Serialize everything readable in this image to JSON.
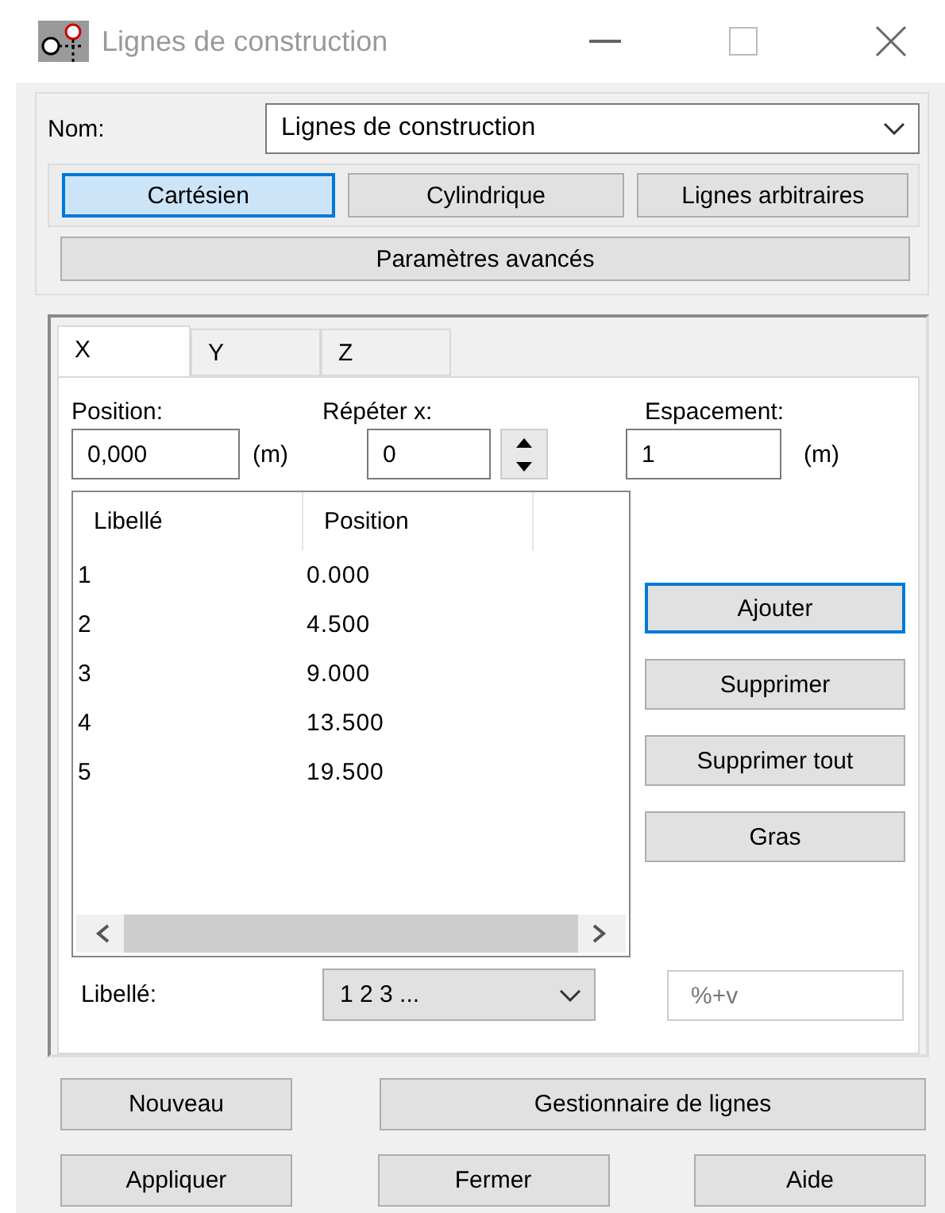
{
  "window": {
    "title": "Lignes de construction",
    "active": false
  },
  "name": {
    "label": "Nom:",
    "value": "Lignes de construction"
  },
  "modes": [
    {
      "label": "Cartésien",
      "selected": true
    },
    {
      "label": "Cylindrique",
      "selected": false
    },
    {
      "label": "Lignes arbitraires",
      "selected": false
    }
  ],
  "advanced_button": "Paramètres avancés",
  "tabs": [
    {
      "label": "X",
      "selected": true
    },
    {
      "label": "Y",
      "selected": false
    },
    {
      "label": "Z",
      "selected": false
    }
  ],
  "position": {
    "label": "Position:",
    "value": "0,000",
    "unit": "(m)"
  },
  "repeat": {
    "label": "Répéter x:",
    "value": "0"
  },
  "spacing": {
    "label": "Espacement:",
    "value": "1",
    "unit": "(m)"
  },
  "table": {
    "columns": [
      "Libellé",
      "Position"
    ],
    "rows": [
      [
        "1",
        "0.000"
      ],
      [
        "2",
        "4.500"
      ],
      [
        "3",
        "9.000"
      ],
      [
        "4",
        "13.500"
      ],
      [
        "5",
        "19.500"
      ]
    ]
  },
  "side_buttons": [
    {
      "label": "Ajouter",
      "focused": true
    },
    {
      "label": "Supprimer",
      "focused": false
    },
    {
      "label": "Supprimer tout",
      "focused": false
    },
    {
      "label": "Gras",
      "focused": false
    }
  ],
  "label_row": {
    "label": "Libellé:",
    "value": "1 2 3 ...",
    "format": "%+v",
    "format_disabled": true
  },
  "bottom_rows": [
    [
      "Nouveau",
      "Gestionnaire de lignes"
    ],
    [
      "Appliquer",
      "Fermer",
      "Aide"
    ]
  ]
}
